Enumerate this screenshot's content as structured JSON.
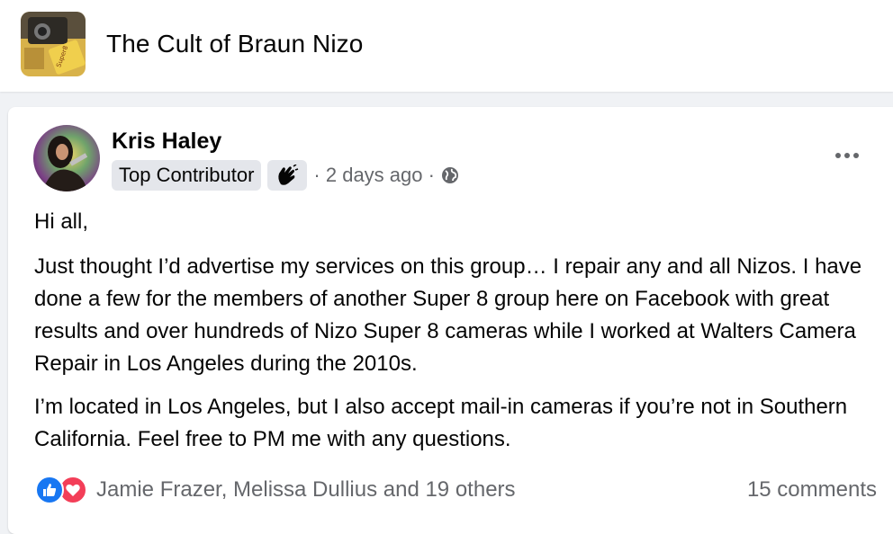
{
  "group": {
    "name": "The Cult of Braun Nizo",
    "thumbnail_icon": "super8-camera-thumbnail"
  },
  "post": {
    "author": "Kris Haley",
    "avatar_icon": "author-avatar",
    "badge": "Top Contributor",
    "badge_icon": "rising-hand-icon",
    "time": "· 2 days ago ·",
    "privacy_icon": "globe-icon",
    "more_icon": "more-options-icon",
    "paragraphs": [
      "Hi all,",
      "Just thought I’d advertise my services on this group… I repair any and all Nizos. I have done a few for the members of another Super 8 group here on Facebook with great results and over hundreds of Nizo Super 8 cameras while I worked at Walters Camera Repair in Los Angeles during the 2010s.",
      "I’m located in Los Angeles, but I also accept mail-in cameras if you’re not in Southern California. Feel free to PM me with any questions."
    ],
    "reactions": {
      "icons": [
        "like-icon",
        "love-icon"
      ],
      "text": "Jamie Frazer, Melissa Dullius and 19 others"
    },
    "comments": "15 comments"
  },
  "colors": {
    "background": "#f0f2f5",
    "card": "#ffffff",
    "secondary_text": "#65676b",
    "like": "#1877f2",
    "love": "#f33e58",
    "badge_bg": "#e4e6eb"
  }
}
